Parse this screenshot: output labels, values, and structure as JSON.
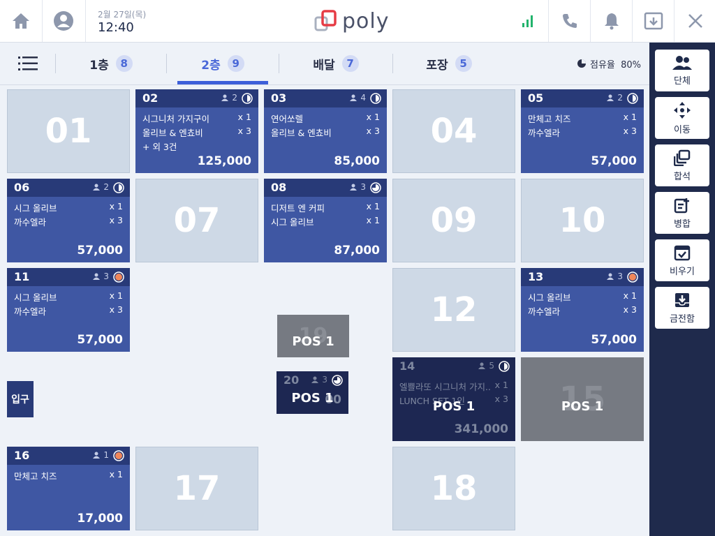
{
  "header": {
    "date": "2월 27일(목)",
    "time": "12:40",
    "logo": "poly",
    "icons": [
      "home-icon",
      "user-icon",
      "signal-icon",
      "phone-icon",
      "bell-icon",
      "download-icon",
      "close-icon"
    ]
  },
  "tabs": [
    {
      "label": "1층",
      "count": "8"
    },
    {
      "label": "2층",
      "count": "9"
    },
    {
      "label": "배달",
      "count": "7"
    },
    {
      "label": "포장",
      "count": "5"
    }
  ],
  "occupancy": "점유율  80%",
  "sidebar": [
    "단체",
    "이동",
    "합석",
    "병합",
    "비우기",
    "금전함"
  ],
  "entrance": "입구",
  "pos_label": "POS 1",
  "tables": {
    "t01": {
      "num": "01"
    },
    "t02": {
      "num": "02",
      "guests": "2",
      "items": [
        [
          "시그니처 가지구이",
          "x 1"
        ],
        [
          "올리브 & 엔쵸비",
          "x 3"
        ],
        [
          "+ 외 3건",
          ""
        ]
      ],
      "total": "125,000"
    },
    "t03": {
      "num": "03",
      "guests": "4",
      "items": [
        [
          "연어쏘렐",
          "x 1"
        ],
        [
          "올리브 & 엔쵸비",
          "x 3"
        ]
      ],
      "total": "85,000"
    },
    "t04": {
      "num": "04"
    },
    "t05": {
      "num": "05",
      "guests": "2",
      "items": [
        [
          "만체고 치즈",
          "x 1"
        ],
        [
          "까수엘라",
          "x 3"
        ]
      ],
      "total": "57,000"
    },
    "t06": {
      "num": "06",
      "guests": "2",
      "items": [
        [
          "시그 올리브",
          "x 1"
        ],
        [
          "까수엘라",
          "x 3"
        ]
      ],
      "total": "57,000"
    },
    "t07": {
      "num": "07"
    },
    "t08": {
      "num": "08",
      "guests": "3",
      "items": [
        [
          "디저트 엔 커피",
          "x 1"
        ],
        [
          "시그 올리브",
          "x 1"
        ]
      ],
      "total": "87,000"
    },
    "t09": {
      "num": "09"
    },
    "t10": {
      "num": "10"
    },
    "t11": {
      "num": "11",
      "guests": "3",
      "items": [
        [
          "시그 올리브",
          "x 1"
        ],
        [
          "까수엘라",
          "x 3"
        ]
      ],
      "total": "57,000"
    },
    "t12": {
      "num": "12"
    },
    "t13": {
      "num": "13",
      "guests": "3",
      "items": [
        [
          "시그 올리브",
          "x 1"
        ],
        [
          "까수엘라",
          "x 3"
        ]
      ],
      "total": "57,000"
    },
    "t14": {
      "num": "14",
      "guests": "5",
      "items": [
        [
          "엘쁠라또 시그니처 가지..",
          "x 1"
        ],
        [
          "LUNCH SET 1인",
          "x 3"
        ]
      ],
      "total": "341,000"
    },
    "t15": {
      "num": "15"
    },
    "t16": {
      "num": "16",
      "guests": "1",
      "items": [
        [
          "만체고 치즈",
          "x 1"
        ]
      ],
      "total": "17,000"
    },
    "t17": {
      "num": "17"
    },
    "t18": {
      "num": "18"
    },
    "t19": {
      "num": "19"
    },
    "t20": {
      "num": "20",
      "guests": "3",
      "total": "00"
    }
  },
  "colors": {
    "accent": "#3d5fd9",
    "occupied": "#3f57a3",
    "header_bar": "#283a78",
    "alert": "#f0875a",
    "sidebar": "#1f2a4c"
  }
}
